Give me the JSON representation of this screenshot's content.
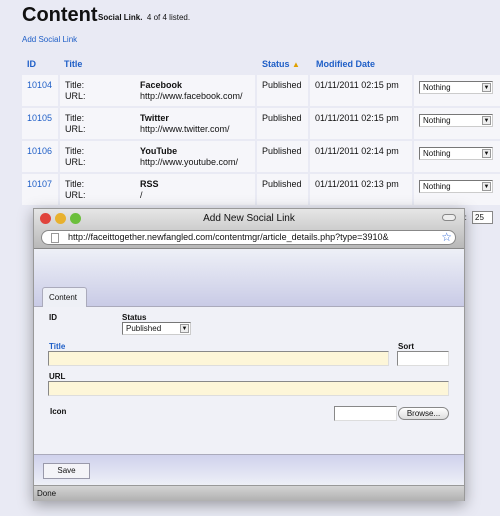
{
  "page": {
    "title": "Content",
    "subtitle_type": "Social Link.",
    "subtitle_count": "4 of 4 listed.",
    "add_link": "Add Social Link"
  },
  "table": {
    "headers": {
      "id": "ID",
      "title": "Title",
      "status": "Status",
      "modified": "Modified Date"
    },
    "sort_icon": "triangle-up-icon",
    "field_labels": {
      "title": "Title:",
      "url": "URL:"
    },
    "rows": [
      {
        "id": "10104",
        "title": "Facebook",
        "url": "http://www.facebook.com/",
        "status": "Published",
        "modified": "01/11/2011 02:15 pm",
        "action": "Nothing"
      },
      {
        "id": "10105",
        "title": "Twitter",
        "url": "http://www.twitter.com/",
        "status": "Published",
        "modified": "01/11/2011 02:15 pm",
        "action": "Nothing"
      },
      {
        "id": "10106",
        "title": "YouTube",
        "url": "http://www.youtube.com/",
        "status": "Published",
        "modified": "01/11/2011 02:14 pm",
        "action": "Nothing"
      },
      {
        "id": "10107",
        "title": "RSS",
        "url": "/",
        "status": "Published",
        "modified": "01/11/2011 02:13 pm",
        "action": "Nothing"
      }
    ]
  },
  "per_page": {
    "label_fragment": "r:",
    "value": "25"
  },
  "popup": {
    "window_title": "Add New Social Link",
    "url": "http://faceittogether.newfangled.com/contentmgr/article_details.php?type=3910&",
    "tab": "Content",
    "form": {
      "id_label": "ID",
      "status_label": "Status",
      "status_value": "Published",
      "title_label": "Title",
      "sort_label": "Sort",
      "url_label": "URL",
      "icon_label": "Icon",
      "browse": "Browse..."
    },
    "save": "Save",
    "status_bar": "Done"
  },
  "colors": {
    "link": "#1f5fc7",
    "required_field": "#fdf6d8",
    "background": "#e9eaf4"
  }
}
